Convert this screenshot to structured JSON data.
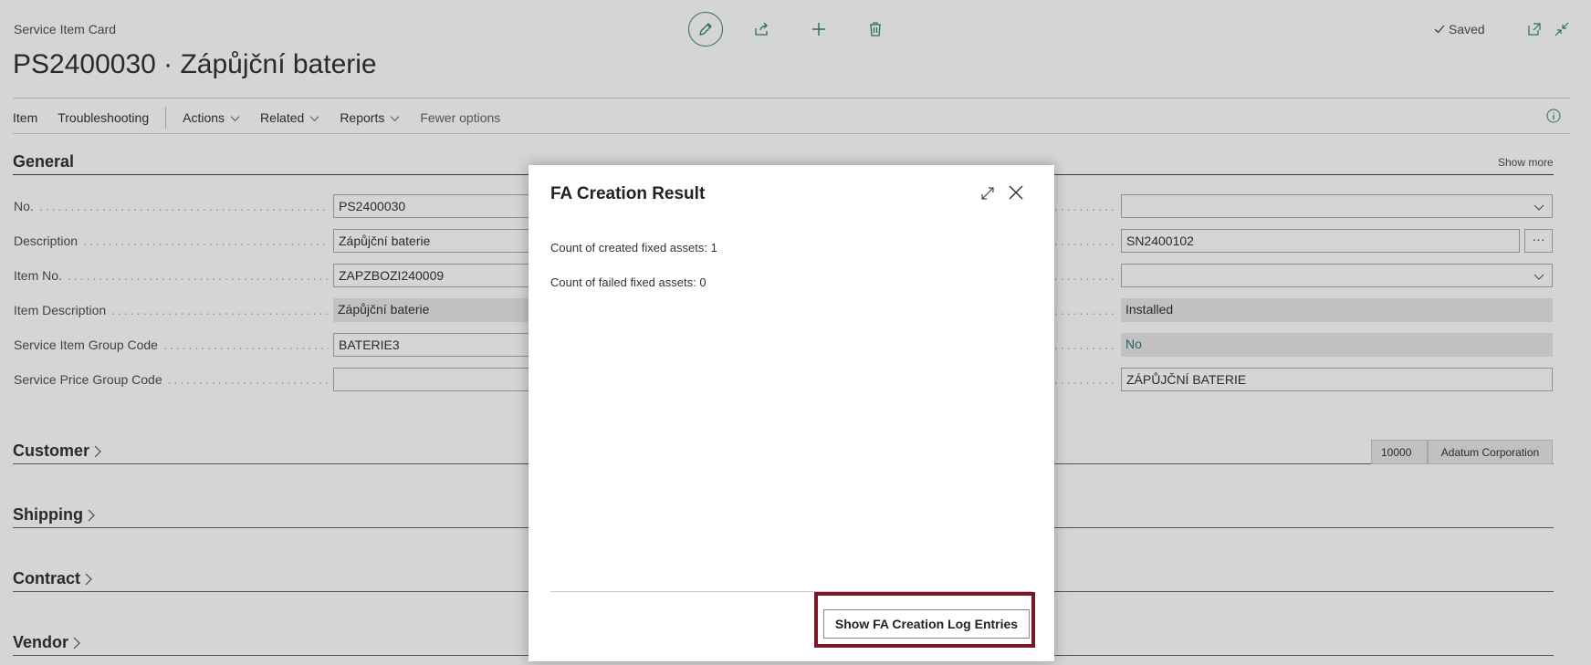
{
  "header": {
    "caption": "Service Item Card",
    "title": "PS2400030 · Zápůjční baterie",
    "saved_label": "Saved"
  },
  "toolbar_icons": [
    "pencil-icon",
    "share-icon",
    "plus-icon",
    "trash-icon"
  ],
  "actionbar": {
    "item": "Item",
    "troubleshooting": "Troubleshooting",
    "actions": "Actions",
    "related": "Related",
    "reports": "Reports",
    "fewer_options": "Fewer options"
  },
  "general": {
    "title": "General",
    "show_more": "Show more",
    "fields": [
      {
        "label": "No.",
        "value": "PS2400030"
      },
      {
        "label": "Description",
        "value": "Zápůjční baterie"
      },
      {
        "label": "Item No.",
        "value": "ZAPZBOZI240009"
      },
      {
        "label": "Item Description",
        "value": "Zápůjční baterie"
      },
      {
        "label": "Service Item Group Code",
        "value": "BATERIE3"
      },
      {
        "label": "Service Price Group Code",
        "value": ""
      }
    ],
    "right_fields": [
      {
        "value": ""
      },
      {
        "value": "SN2400102"
      },
      {
        "value": ""
      },
      {
        "value": "Installed"
      },
      {
        "value": "No"
      },
      {
        "value": "ZÁPŮJČNÍ BATERIE"
      }
    ]
  },
  "sections": {
    "customer": "Customer",
    "shipping": "Shipping",
    "contract": "Contract",
    "vendor": "Vendor"
  },
  "customer_summary": {
    "no": "10000",
    "name": "Adatum Corporation"
  },
  "dialog": {
    "title": "FA Creation Result",
    "line1": "Count of created fixed assets: 1",
    "line2": "Count of failed fixed assets: 0",
    "button": "Show FA Creation Log Entries"
  },
  "colors": {
    "accent": "#3a7f7a",
    "highlight": "#7a1628"
  }
}
